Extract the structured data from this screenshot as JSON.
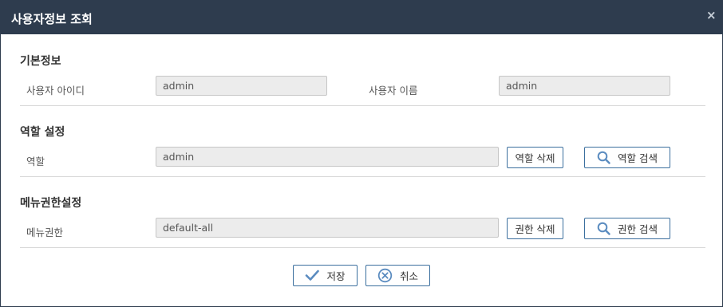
{
  "dialog": {
    "title": "사용자정보 조회",
    "close_glyph": "×"
  },
  "basic_info": {
    "heading": "기본정보",
    "user_id_label": "사용자 아이디",
    "user_id_value": "admin",
    "user_name_label": "사용자 이름",
    "user_name_value": "admin"
  },
  "role_setting": {
    "heading": "역할 설정",
    "role_label": "역할",
    "role_value": "admin",
    "delete_button": "역할 삭제",
    "search_button": "역할 검색"
  },
  "menu_permission": {
    "heading": "메뉴권한설정",
    "permission_label": "메뉴권한",
    "permission_value": "default-all",
    "delete_button": "권한 삭제",
    "search_button": "권한 검색"
  },
  "footer": {
    "save_button": "저장",
    "cancel_button": "취소"
  },
  "colors": {
    "titlebar": "#2e3c4e",
    "button_border": "#3b6f9e",
    "icon": "#5b8cc0"
  },
  "icons": {
    "search": "search-icon",
    "save": "check-icon",
    "cancel": "circle-x-icon"
  }
}
